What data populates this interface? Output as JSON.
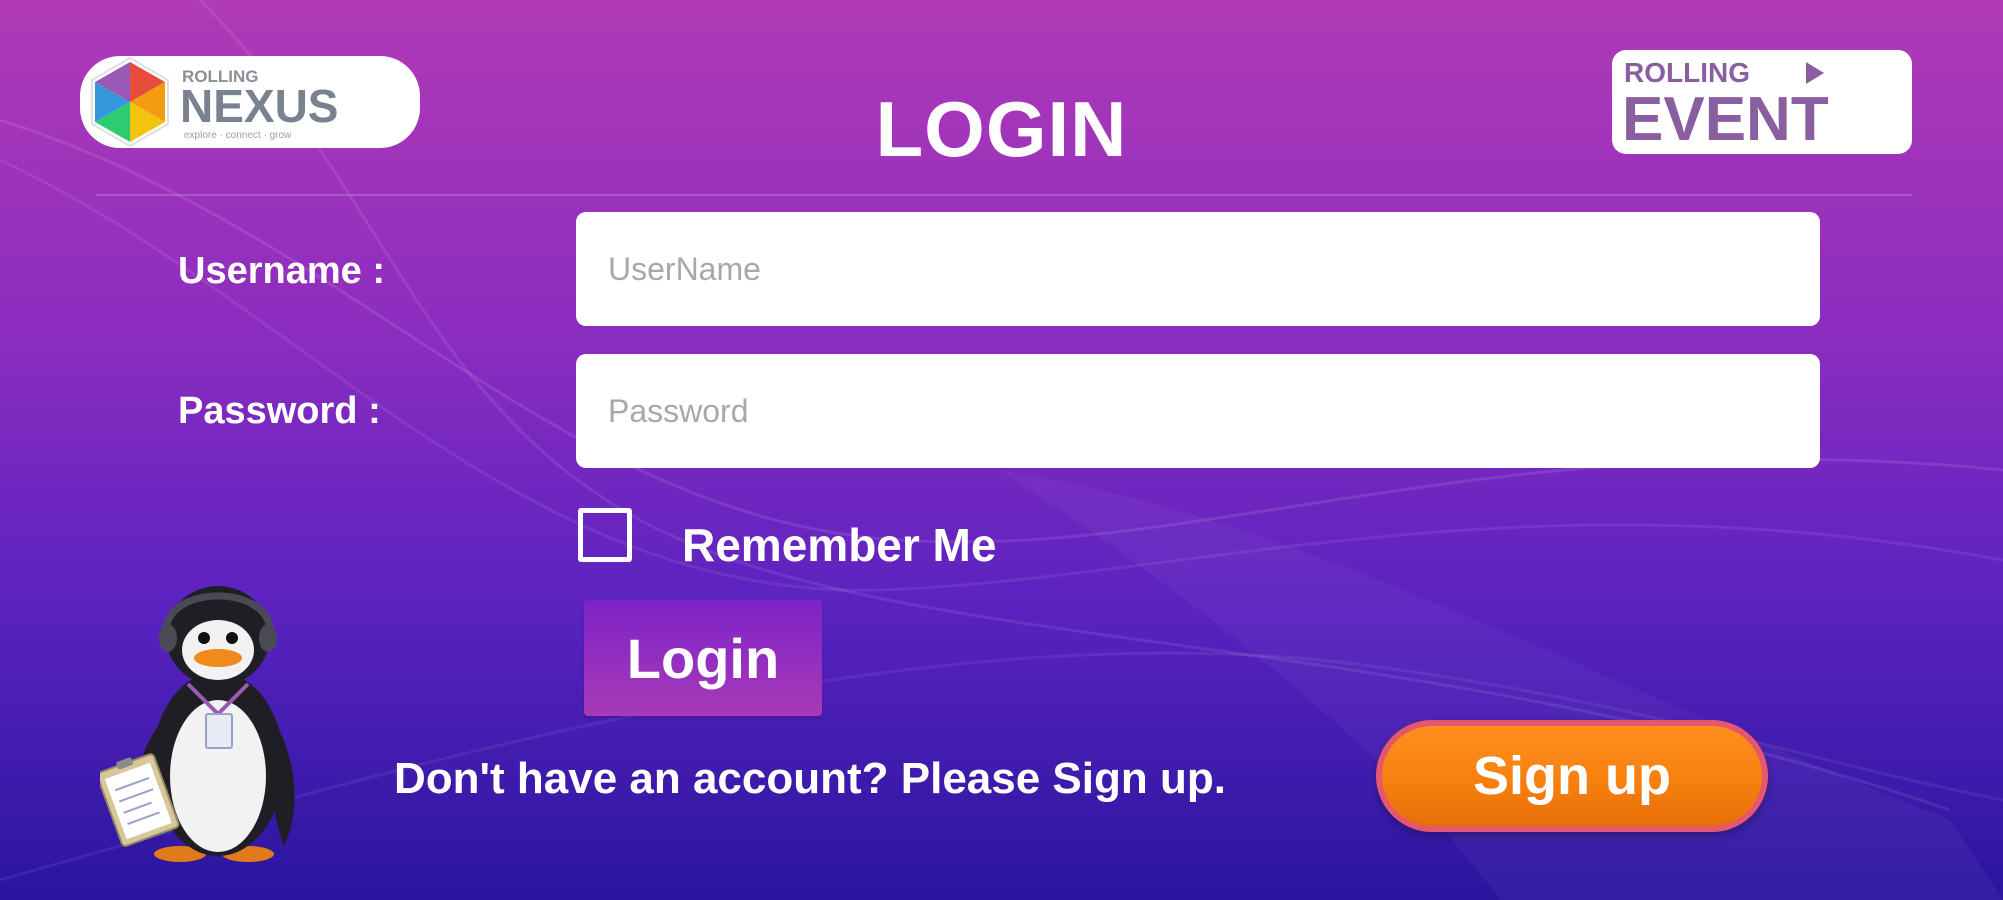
{
  "header": {
    "title": "LOGIN",
    "logo_left": {
      "top": "ROLLING",
      "main": "NEXUS",
      "tagline": "explore · connect · grow"
    },
    "logo_right": {
      "top": "ROLLING",
      "main": "EVENT"
    }
  },
  "form": {
    "username_label": "Username :",
    "username_placeholder": "UserName",
    "username_value": "",
    "password_label": "Password :",
    "password_placeholder": "Password",
    "password_value": "",
    "remember_label": "Remember Me",
    "remember_checked": false,
    "login_label": "Login"
  },
  "footer": {
    "signup_prompt": "Don't have an account? Please Sign up.",
    "signup_label": "Sign up"
  },
  "colors": {
    "bg_top": "#b13ab6",
    "bg_bottom": "#2a159e",
    "login_button": "#8a2cc0",
    "signup_button": "#f57f0d",
    "signup_border": "#e4576c"
  },
  "icons": {
    "checkbox": "checkbox-unchecked-icon",
    "mascot": "penguin-mascot",
    "logo_left_icon": "hexagon-color-icon",
    "logo_right_icon": "play-arrow-icon"
  }
}
